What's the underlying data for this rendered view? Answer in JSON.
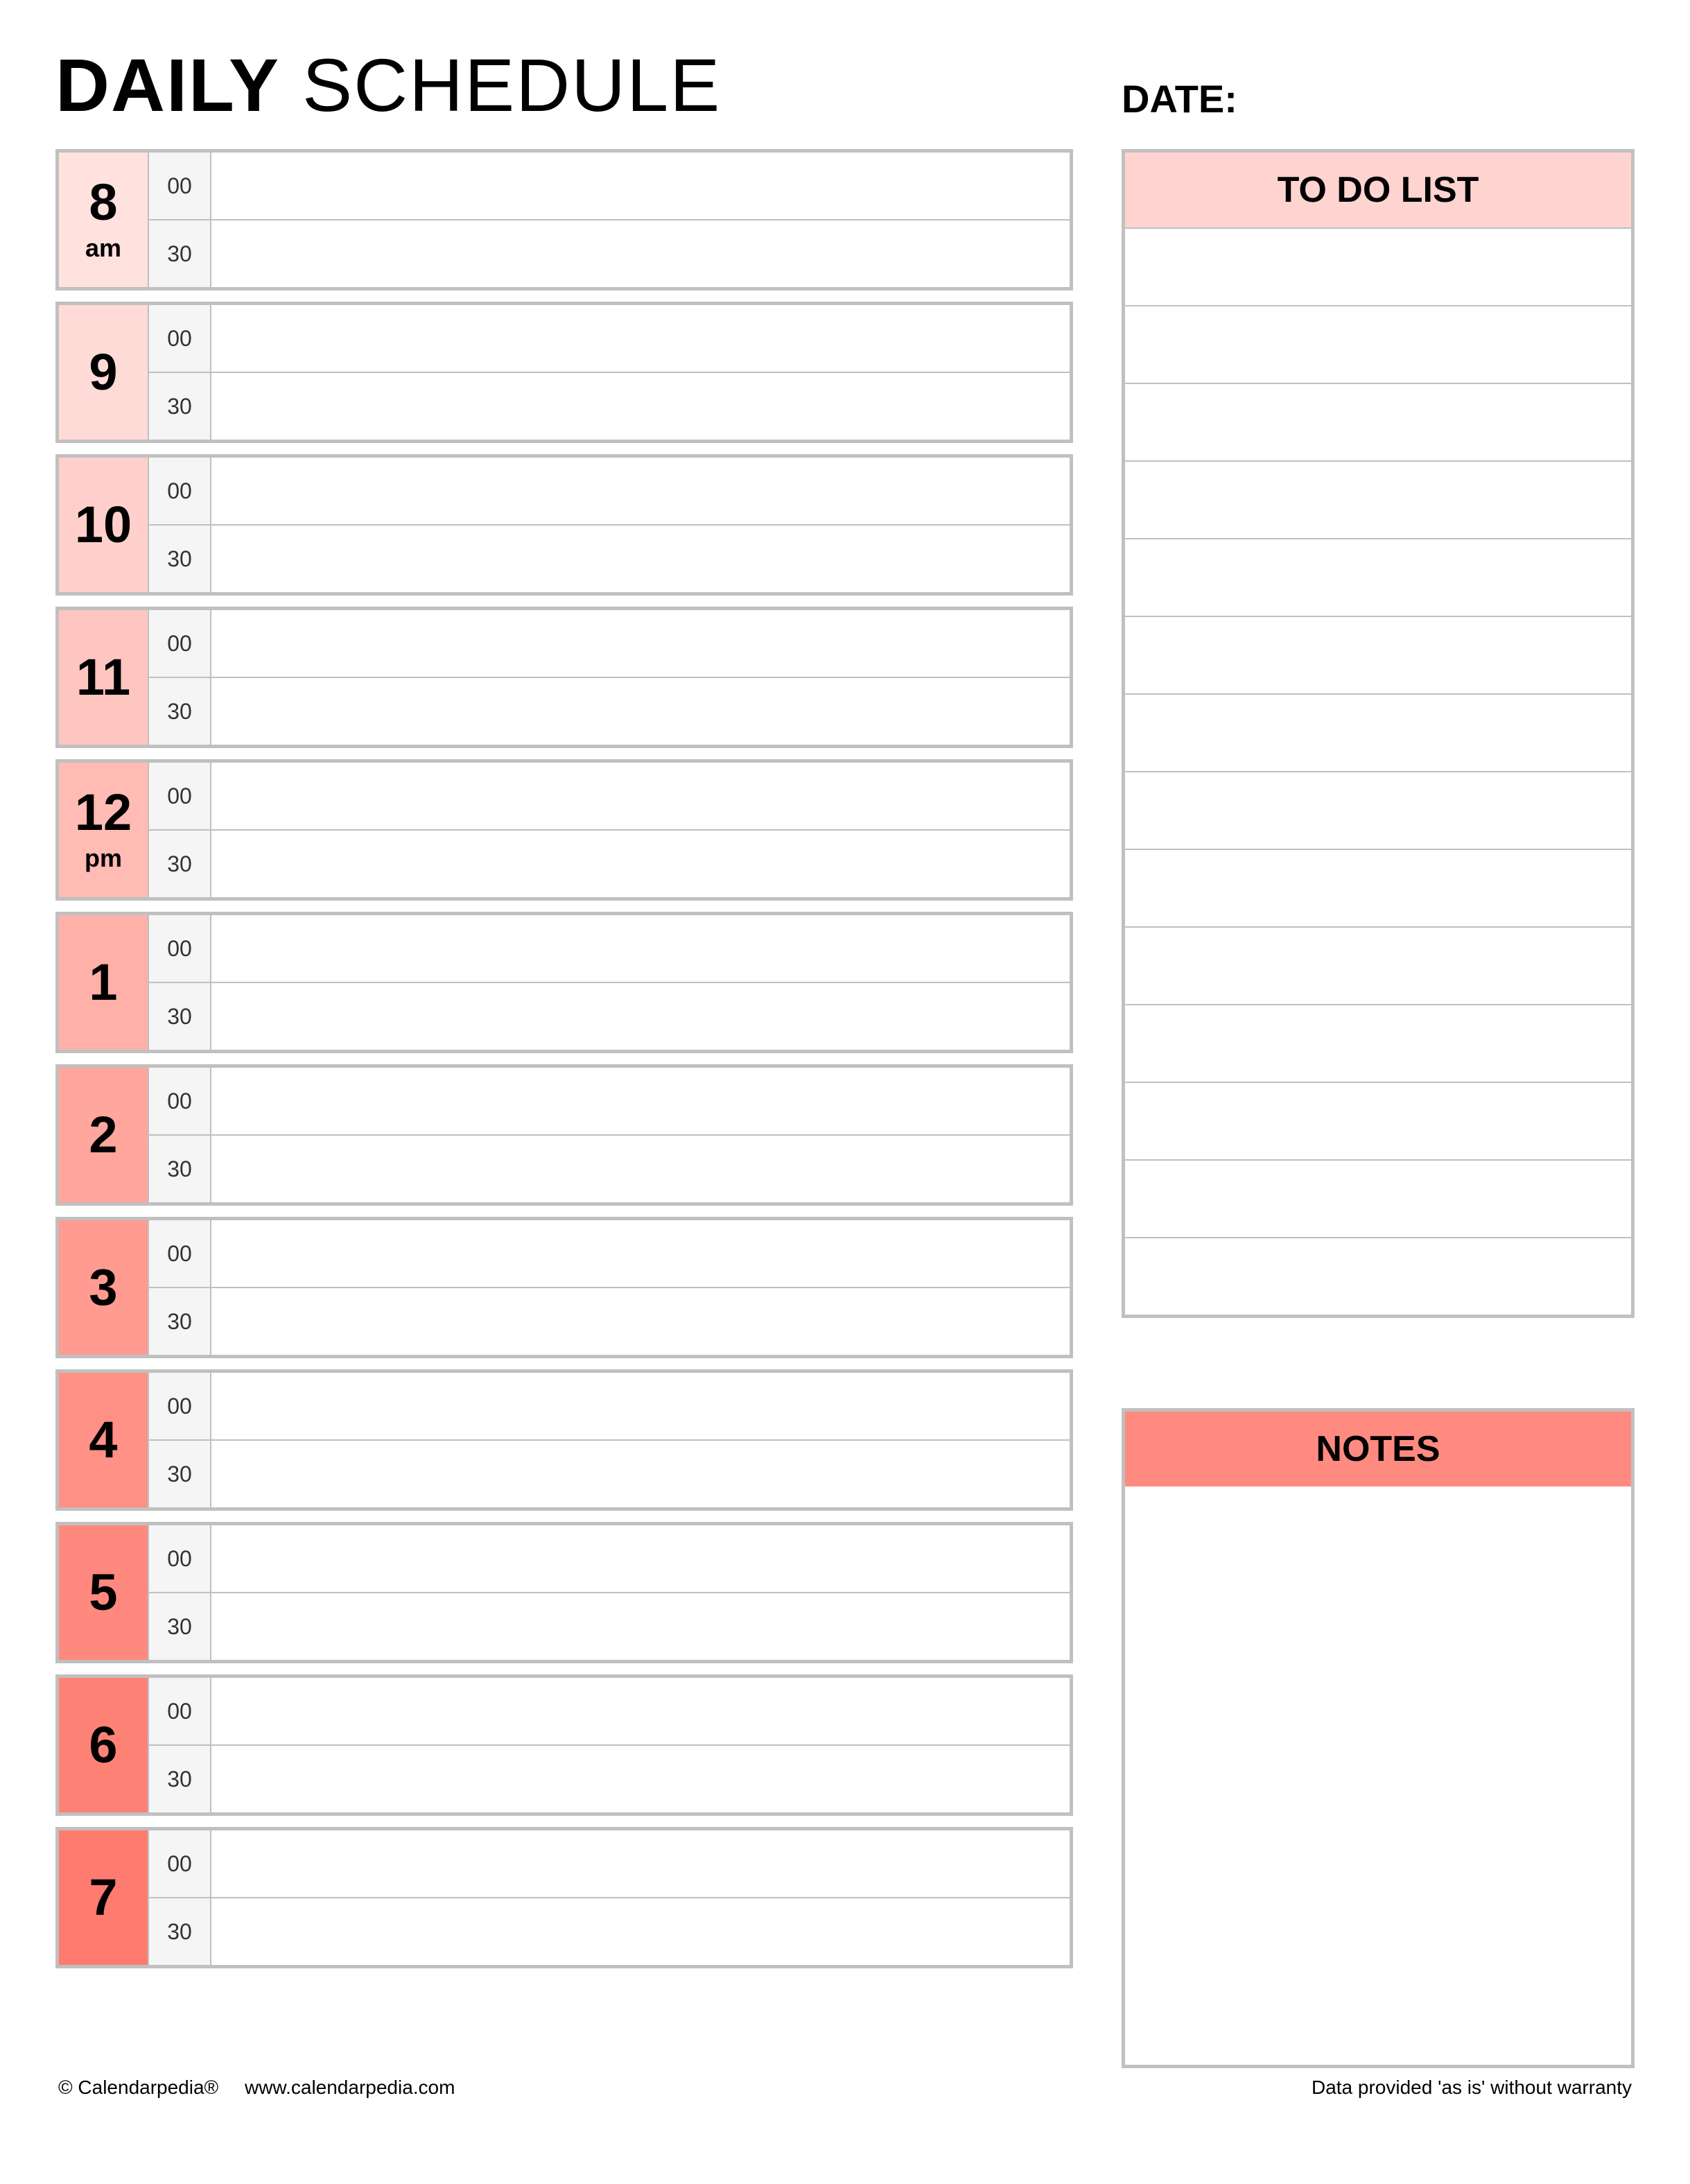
{
  "header": {
    "title_bold": "DAILY",
    "title_light": " SCHEDULE",
    "date_label": "DATE:"
  },
  "schedule": {
    "min_00": "00",
    "min_30": "30",
    "hours": [
      {
        "num": "8",
        "ampm": "am",
        "color": "c0"
      },
      {
        "num": "9",
        "ampm": "",
        "color": "c1"
      },
      {
        "num": "10",
        "ampm": "",
        "color": "c2"
      },
      {
        "num": "11",
        "ampm": "",
        "color": "c3"
      },
      {
        "num": "12",
        "ampm": "pm",
        "color": "c4"
      },
      {
        "num": "1",
        "ampm": "",
        "color": "c5"
      },
      {
        "num": "2",
        "ampm": "",
        "color": "c6"
      },
      {
        "num": "3",
        "ampm": "",
        "color": "c7"
      },
      {
        "num": "4",
        "ampm": "",
        "color": "c8"
      },
      {
        "num": "5",
        "ampm": "",
        "color": "c9"
      },
      {
        "num": "6",
        "ampm": "",
        "color": "c10"
      },
      {
        "num": "7",
        "ampm": "",
        "color": "c11"
      }
    ]
  },
  "todo": {
    "title": "TO DO LIST",
    "rows": 14
  },
  "notes": {
    "title": "NOTES"
  },
  "footer": {
    "copyright": "© Calendarpedia®",
    "url": "www.calendarpedia.com",
    "disclaimer": "Data provided 'as is' without warranty"
  }
}
